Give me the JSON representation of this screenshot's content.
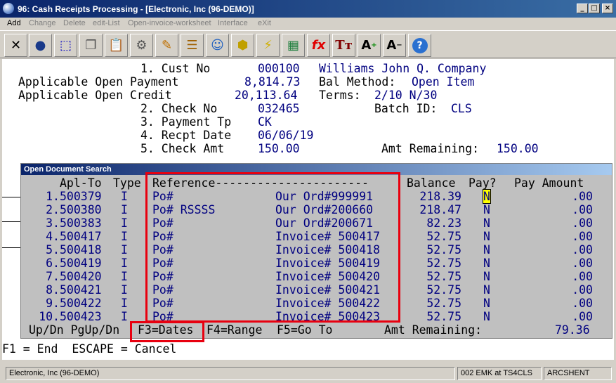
{
  "window": {
    "title": "96: Cash Receipts Processing - [Electronic, Inc (96-DEMO)]"
  },
  "menu": [
    "Add",
    "Change",
    "Delete",
    "edit-List",
    "Open-invoice-worksheet",
    "Interface",
    "eXit"
  ],
  "toolbar": [
    "close",
    "globe",
    "select",
    "copy",
    "paste",
    "settings",
    "edit",
    "notes",
    "users",
    "tag",
    "lightning",
    "worksheet",
    "function",
    "font-type",
    "font-larger",
    "font-smaller",
    "help"
  ],
  "form": {
    "cust_no": {
      "label": "1. Cust No",
      "value": "000100",
      "name": "Williams John Q. Company"
    },
    "open_payment": {
      "label": "Applicable Open Payment",
      "value": "8,814.73"
    },
    "bal_method": {
      "label": "Bal Method:",
      "value": "Open Item"
    },
    "open_credit": {
      "label": "Applicable Open Credit",
      "value": "20,113.64"
    },
    "terms": {
      "label": "Terms:",
      "value": "2/10 N/30"
    },
    "check_no": {
      "label": "2. Check No",
      "value": "032465"
    },
    "batch_id": {
      "label": "Batch ID:",
      "value": "CLS"
    },
    "payment_tp": {
      "label": "3. Payment Tp",
      "value": "CK"
    },
    "recpt_date": {
      "label": "4. Recpt Date",
      "value": "06/06/19"
    },
    "check_amt": {
      "label": "5. Check Amt",
      "value": "150.00"
    },
    "amt_remaining": {
      "label": "Amt Remaining:",
      "value": "150.00"
    }
  },
  "search": {
    "title": "Open Document Search",
    "headers": {
      "aplto": "Apl-To",
      "type": "Type",
      "reference": "Reference----------------------",
      "balance": "Balance",
      "pay": "Pay?",
      "payamt": "Pay Amount"
    },
    "rows": [
      {
        "num": "1.",
        "aplto": "500379",
        "type": "I",
        "ref1": "Po#",
        "ref2": "Our Ord#999991",
        "balance": "218.39",
        "pay": "N",
        "payamt": ".00"
      },
      {
        "num": "2.",
        "aplto": "500380",
        "type": "I",
        "ref1": "Po# RSSSS",
        "ref2": "Our Ord#200660",
        "balance": "218.47",
        "pay": "N",
        "payamt": ".00"
      },
      {
        "num": "3.",
        "aplto": "500383",
        "type": "I",
        "ref1": "Po#",
        "ref2": "Our Ord#200671",
        "balance": "82.23",
        "pay": "N",
        "payamt": ".00"
      },
      {
        "num": "4.",
        "aplto": "500417",
        "type": "I",
        "ref1": "Po#",
        "ref2": "Invoice# 500417",
        "balance": "52.75",
        "pay": "N",
        "payamt": ".00"
      },
      {
        "num": "5.",
        "aplto": "500418",
        "type": "I",
        "ref1": "Po#",
        "ref2": "Invoice# 500418",
        "balance": "52.75",
        "pay": "N",
        "payamt": ".00"
      },
      {
        "num": "6.",
        "aplto": "500419",
        "type": "I",
        "ref1": "Po#",
        "ref2": "Invoice# 500419",
        "balance": "52.75",
        "pay": "N",
        "payamt": ".00"
      },
      {
        "num": "7.",
        "aplto": "500420",
        "type": "I",
        "ref1": "Po#",
        "ref2": "Invoice# 500420",
        "balance": "52.75",
        "pay": "N",
        "payamt": ".00"
      },
      {
        "num": "8.",
        "aplto": "500421",
        "type": "I",
        "ref1": "Po#",
        "ref2": "Invoice# 500421",
        "balance": "52.75",
        "pay": "N",
        "payamt": ".00"
      },
      {
        "num": "9.",
        "aplto": "500422",
        "type": "I",
        "ref1": "Po#",
        "ref2": "Invoice# 500422",
        "balance": "52.75",
        "pay": "N",
        "payamt": ".00"
      },
      {
        "num": "10.",
        "aplto": "500423",
        "type": "I",
        "ref1": "Po#",
        "ref2": "Invoice# 500423",
        "balance": "52.75",
        "pay": "N",
        "payamt": ".00"
      }
    ],
    "footer": {
      "nav": "Up/Dn PgUp/Dn",
      "f3": "F3=Dates",
      "f4": "F4=Range",
      "f5": "F5=Go To",
      "remaining_label": "Amt Remaining:",
      "remaining_value": "79.36"
    }
  },
  "keys": "F1 = End  ESCAPE = Cancel",
  "status": {
    "company": "Electronic, Inc (96-DEMO)",
    "user": "002 EMK at TS4CLS",
    "server": "ARCSHENT"
  },
  "colors": {
    "highlight": "#e8000f",
    "value_text": "#000080",
    "selected_bg": "#ffff00"
  }
}
